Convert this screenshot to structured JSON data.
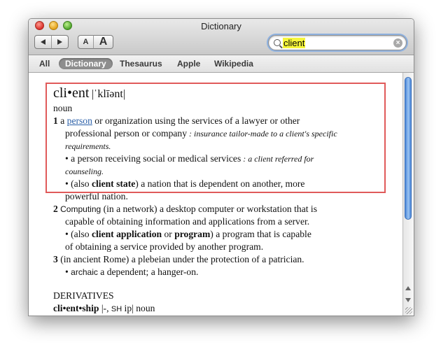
{
  "window": {
    "title": "Dictionary"
  },
  "toolbar": {
    "font_small_label": "A",
    "font_large_label": "A"
  },
  "search": {
    "value": "client"
  },
  "scopes": [
    "All",
    "Dictionary",
    "Thesaurus",
    "Apple",
    "Wikipedia"
  ],
  "entry": {
    "headword": "cli•ent",
    "pronunciation": "|ˈklīənt|",
    "pos": "noun",
    "s1": {
      "num": "1",
      "pre": " a ",
      "link": "person",
      "post": " or organization using the services of a lawyer or other",
      "cont": "professional person or company",
      "ex1": " : insurance tailor-made to a client's specific",
      "ex2": "requirements.",
      "sub1": "• a person receiving social or medical services",
      "sub1_ex1": " : a client referred for",
      "sub1_ex2": "counseling.",
      "sub2_pre": "• (also ",
      "sub2_bold": "client state",
      "sub2_post": ") a nation that is dependent on another, more",
      "sub2_cont": "powerful nation."
    },
    "s2": {
      "num": "2",
      "label": " Computing",
      "text": " (in a network) a desktop computer or workstation that is",
      "cont": "capable of obtaining information and applications from a server.",
      "sub_pre": "• (also ",
      "sub_bold1": "client application",
      "sub_mid": " or ",
      "sub_bold2": "program",
      "sub_post": ") a program that is capable",
      "sub_cont": "of obtaining a service provided by another program."
    },
    "s3": {
      "num": "3",
      "text": " (in ancient Rome) a plebeian under the protection of a patrician.",
      "sub_bullet": "• ",
      "sub_label": "archaic",
      "sub_text": " a dependent; a hanger-on."
    },
    "derivatives_heading": "DERIVATIVES",
    "deriv_word": "cli•ent•ship",
    "deriv_pron1": " |-, ",
    "deriv_sh": "SH",
    "deriv_pron2": " ip|",
    "deriv_pos": " noun"
  }
}
